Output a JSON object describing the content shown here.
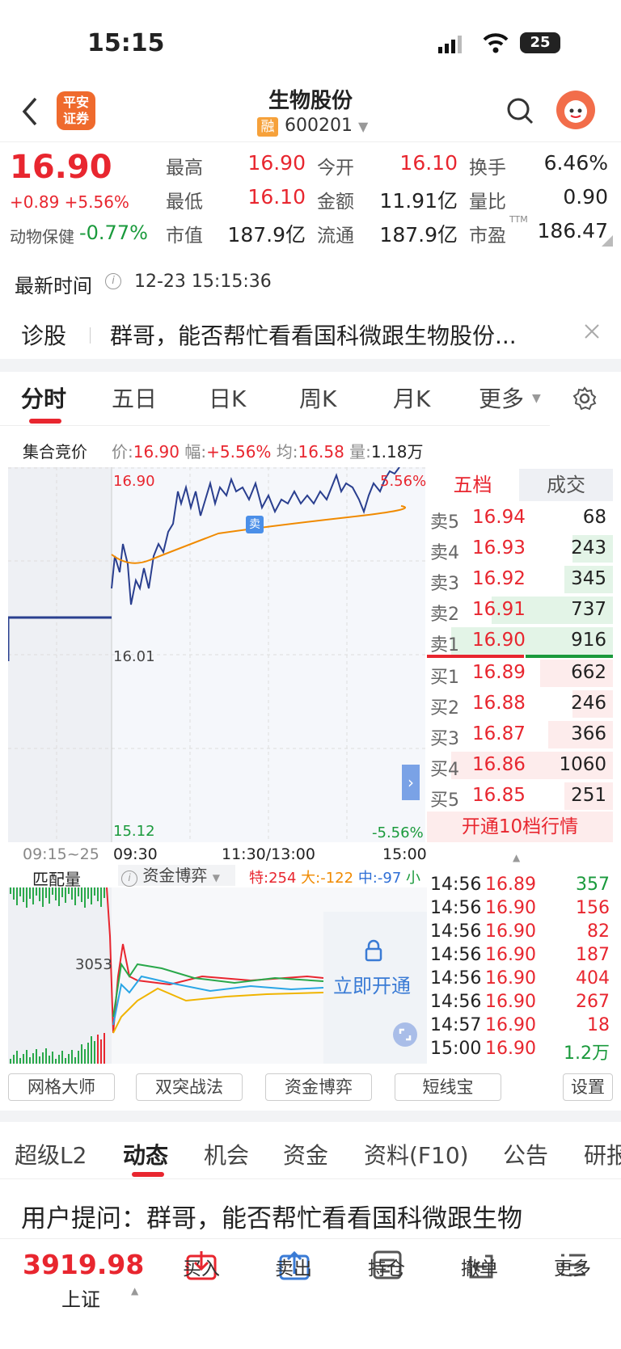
{
  "status": {
    "time": "15:15",
    "battery": "25"
  },
  "header": {
    "title": "生物股份",
    "rong": "融",
    "code": "600201"
  },
  "logo": {
    "line1": "平安",
    "line2": "证券"
  },
  "quote": {
    "price": "16.90",
    "change": "+0.89 +5.56%",
    "sector": "动物保健",
    "sector_change": "-0.77%",
    "stats": [
      {
        "label": "最高",
        "value": "16.90",
        "color": "red"
      },
      {
        "label": "今开",
        "value": "16.10",
        "color": "red"
      },
      {
        "label": "换手",
        "value": "6.46%",
        "color": "black"
      },
      {
        "label": "最低",
        "value": "16.10",
        "color": "red"
      },
      {
        "label": "金额",
        "value": "11.91亿",
        "color": "black"
      },
      {
        "label": "量比",
        "value": "0.90",
        "color": "black"
      },
      {
        "label": "市值",
        "value": "187.9亿",
        "color": "black"
      },
      {
        "label": "流通",
        "value": "187.9亿",
        "color": "black"
      },
      {
        "label": "市盈",
        "value": "186.47",
        "color": "black"
      }
    ],
    "ttm": "TTM",
    "update_label": "最新时间",
    "update_time": "12-23 15:15:36"
  },
  "diagnose": {
    "label": "诊股",
    "text": "群哥，能否帮忙看看国科微跟生物股份..."
  },
  "tabs": [
    "分时",
    "五日",
    "日K",
    "周K",
    "月K",
    "更多"
  ],
  "auction": {
    "label": "集合竞价",
    "price_label": "价:",
    "price": "16.90",
    "amp_label": "幅:",
    "amp": "+5.56%",
    "avg_label": "均:",
    "avg": "16.58",
    "vol_label": "量:",
    "vol": "1.18万"
  },
  "chart": {
    "top": "16.90",
    "mid": "16.01",
    "bottom": "15.12",
    "pct_top": "5.56%",
    "pct_bottom": "-5.56%",
    "sell_tag": "卖",
    "times": [
      "09:15~25",
      "09:30",
      "11:30/13:00",
      "15:00"
    ]
  },
  "sub": {
    "label": "匹配量",
    "indicator": "资金博弈",
    "te": "特:254",
    "da": "大:-122",
    "zhong": "中:-97",
    "xiao": "小",
    "value": "3053",
    "unlock": "立即开通"
  },
  "orderbook": {
    "tab1": "五档",
    "tab2": "成交",
    "asks": [
      {
        "l": "卖5",
        "p": "16.94",
        "v": "68"
      },
      {
        "l": "卖4",
        "p": "16.93",
        "v": "243"
      },
      {
        "l": "卖3",
        "p": "16.92",
        "v": "345"
      },
      {
        "l": "卖2",
        "p": "16.91",
        "v": "737"
      },
      {
        "l": "卖1",
        "p": "16.90",
        "v": "916"
      }
    ],
    "bids": [
      {
        "l": "买1",
        "p": "16.89",
        "v": "662"
      },
      {
        "l": "买2",
        "p": "16.88",
        "v": "246"
      },
      {
        "l": "买3",
        "p": "16.87",
        "v": "366"
      },
      {
        "l": "买4",
        "p": "16.86",
        "v": "1060"
      },
      {
        "l": "买5",
        "p": "16.85",
        "v": "251"
      }
    ],
    "open10": "开通10档行情"
  },
  "trades": [
    {
      "t": "14:56",
      "p": "16.89",
      "v": "357",
      "c": "green"
    },
    {
      "t": "14:56",
      "p": "16.90",
      "v": "156",
      "c": "red"
    },
    {
      "t": "14:56",
      "p": "16.90",
      "v": "82",
      "c": "red"
    },
    {
      "t": "14:56",
      "p": "16.90",
      "v": "187",
      "c": "red"
    },
    {
      "t": "14:56",
      "p": "16.90",
      "v": "404",
      "c": "red"
    },
    {
      "t": "14:56",
      "p": "16.90",
      "v": "267",
      "c": "red"
    },
    {
      "t": "14:57",
      "p": "16.90",
      "v": "18",
      "c": "red"
    },
    {
      "t": "15:00",
      "p": "16.90",
      "v": "1.2万",
      "c": "green"
    }
  ],
  "tools": [
    "网格大师",
    "双突战法",
    "资金博弈",
    "短线宝",
    "设置"
  ],
  "bottom_tabs": [
    "超级L2",
    "动态",
    "机会",
    "资金",
    "资料(F10)",
    "公告",
    "研报"
  ],
  "feed": "用户提问：群哥，能否帮忙看看国科微跟生物",
  "index": {
    "value": "3919.98",
    "name": "上证"
  },
  "actions": [
    "买入",
    "卖出",
    "持仓",
    "撤单",
    "更多"
  ]
}
